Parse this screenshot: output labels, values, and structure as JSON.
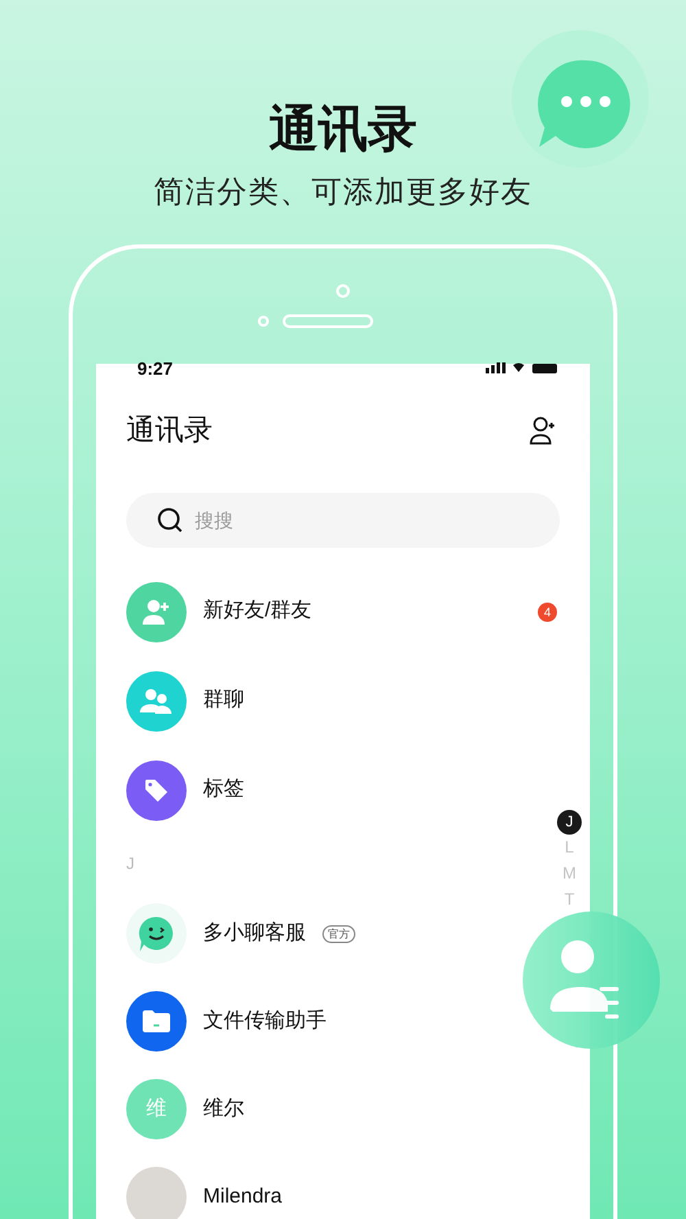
{
  "headline": {
    "title": "通讯录",
    "subtitle": "简洁分类、可添加更多好友"
  },
  "screen": {
    "status_bar": {
      "time": "9:27"
    },
    "header": {
      "title": "通讯录"
    },
    "search": {
      "placeholder": "搜搜"
    },
    "entries": [
      {
        "kind": "add-user",
        "name": "新好友/群友",
        "badge": "4"
      },
      {
        "kind": "group",
        "name": "群聊"
      },
      {
        "kind": "tag",
        "name": "标签"
      }
    ],
    "section": "J",
    "contacts": [
      {
        "kind": "bot",
        "name": "多小聊客服",
        "tag": "官方"
      },
      {
        "kind": "folder",
        "name": "文件传输助手"
      },
      {
        "kind": "initial",
        "initial": "维",
        "name": "维尔"
      },
      {
        "kind": "photo",
        "name": "Milendra"
      }
    ],
    "index": [
      {
        "letter": "J",
        "selected": true
      },
      {
        "letter": "L",
        "selected": false
      },
      {
        "letter": "M",
        "selected": false
      },
      {
        "letter": "T",
        "selected": false
      }
    ]
  }
}
